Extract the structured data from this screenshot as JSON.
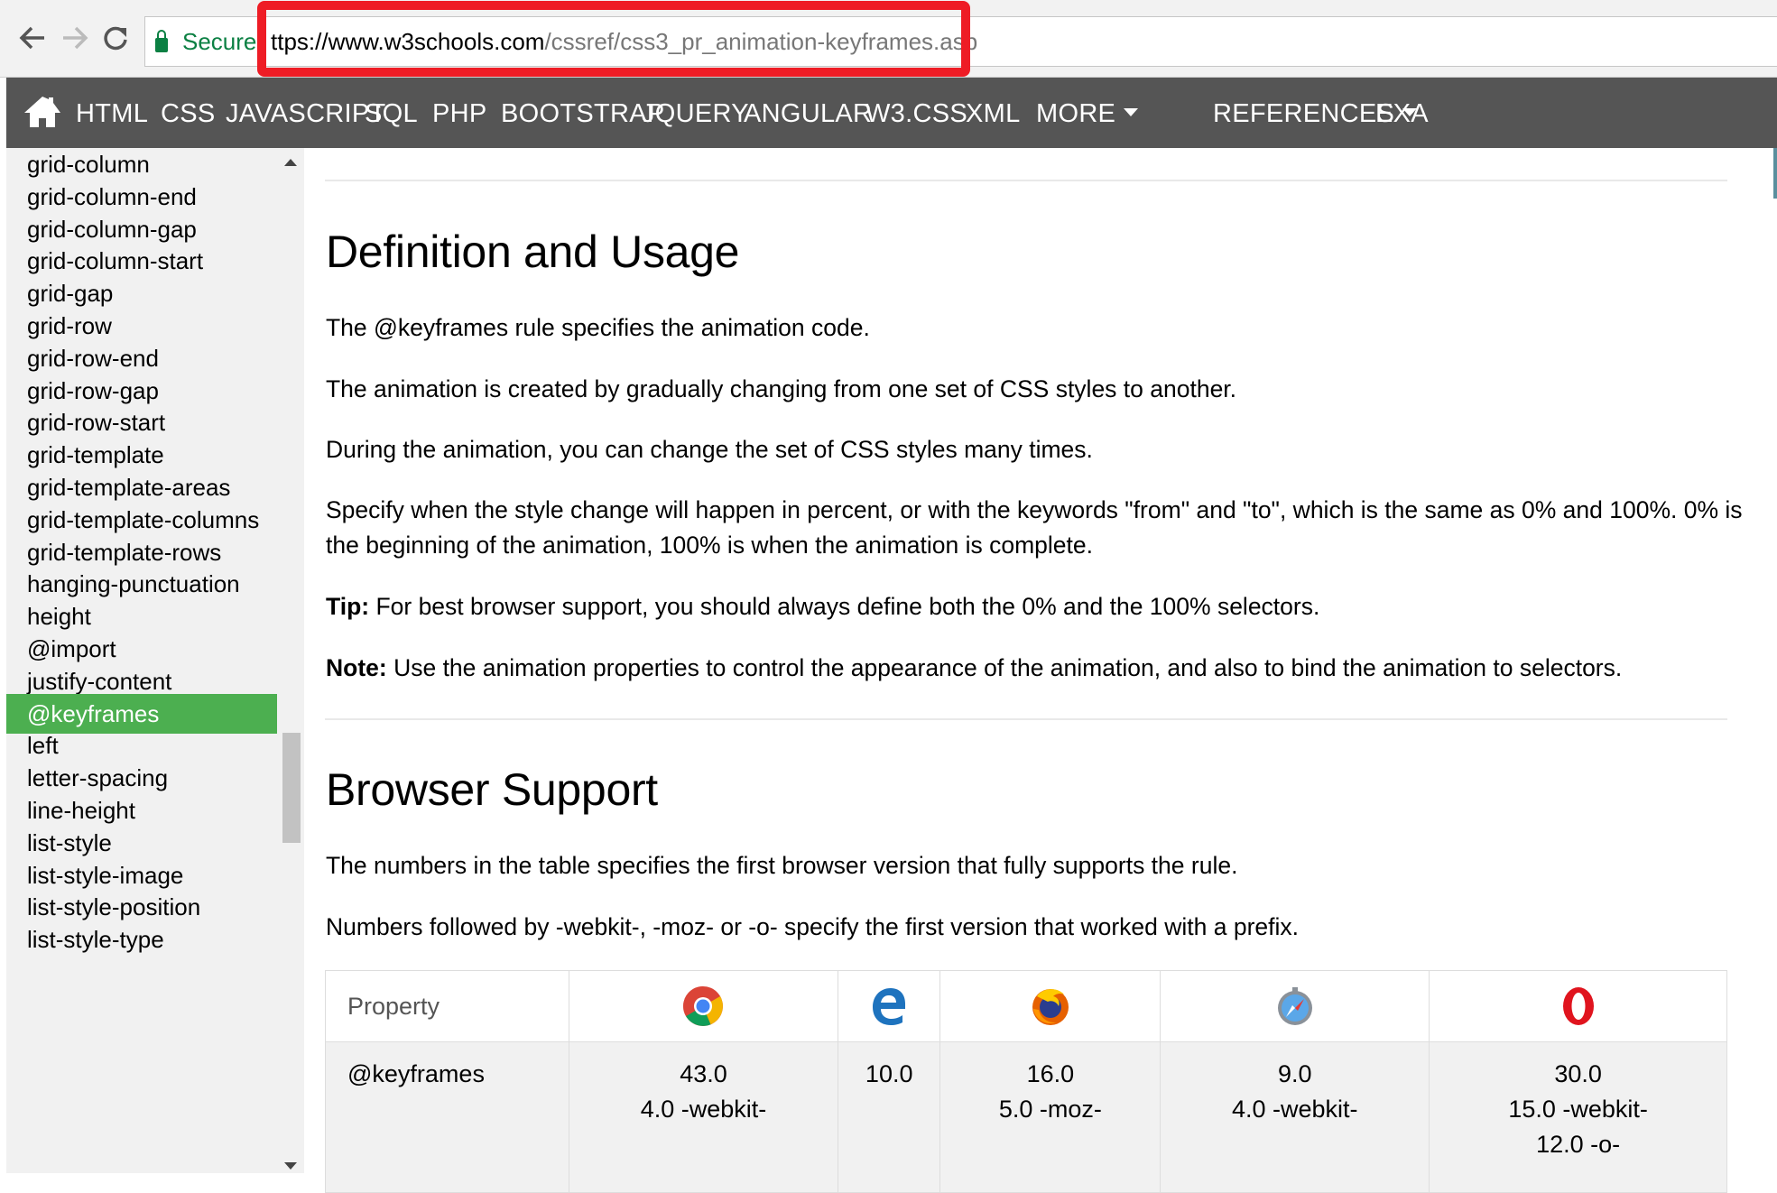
{
  "browser": {
    "secure_label": "Secure",
    "url_scheme": "https://",
    "url_host": "www.w3schools.com",
    "url_path": "/cssref/css3_pr_animation-keyframes.asp",
    "url_display_host": "ttps://www.w3schools.com",
    "back_icon": "back-arrow-icon",
    "forward_icon": "forward-arrow-icon",
    "reload_icon": "reload-icon",
    "highlight_color": "#ee1c25"
  },
  "topnav": {
    "items": [
      "HTML",
      "CSS",
      "JAVASCRIPT",
      "SQL",
      "PHP",
      "BOOTSTRAP",
      "JQUERY",
      "ANGULAR",
      "W3.CSS",
      "XML"
    ],
    "more": "MORE",
    "references": "REFERENCES",
    "exa": "EXA",
    "background": "#555555"
  },
  "sidebar": {
    "items": [
      "grid-column",
      "grid-column-end",
      "grid-column-gap",
      "grid-column-start",
      "grid-gap",
      "grid-row",
      "grid-row-end",
      "grid-row-gap",
      "grid-row-start",
      "grid-template",
      "grid-template-areas",
      "grid-template-columns",
      "grid-template-rows",
      "hanging-punctuation",
      "height",
      "@import",
      "justify-content",
      "@keyframes",
      "left",
      "letter-spacing",
      "line-height",
      "list-style",
      "list-style-image",
      "list-style-position",
      "list-style-type"
    ],
    "active": "@keyframes",
    "active_color": "#4caf50"
  },
  "main": {
    "definition_heading": "Definition and Usage",
    "p1": "The @keyframes rule specifies the animation code.",
    "p2": "The animation is created by gradually changing from one set of CSS styles to another.",
    "p3": "During the animation, you can change the set of CSS styles many times.",
    "p4_line1": "Specify when the style change will happen in percent, or with the keywords \"from\" and \"to\", which is the same as 0% and 100%. 0% is",
    "p4_line2": "the beginning of the animation, 100% is when the animation is complete.",
    "tip_label": "Tip:",
    "tip_text": " For best browser support, you should always define both the 0% and the 100% selectors.",
    "note_label": "Note:",
    "note_text": " Use the animation properties to control the appearance of the animation, and also to bind the animation to selectors.",
    "support_heading": "Browser Support",
    "support_p1": "The numbers in the table specifies the first browser version that fully supports the rule.",
    "support_p2": "Numbers followed by -webkit-, -moz- or -o- specify the first version that worked with a prefix."
  },
  "table": {
    "header_property": "Property",
    "browsers": [
      "chrome-icon",
      "edge-icon",
      "firefox-icon",
      "safari-icon",
      "opera-icon"
    ],
    "row": {
      "property": "@keyframes",
      "chrome": [
        "43.0",
        "4.0 -webkit-"
      ],
      "edge": [
        "10.0"
      ],
      "firefox": [
        "16.0",
        "5.0 -moz-"
      ],
      "safari": [
        "9.0",
        "4.0 -webkit-"
      ],
      "opera": [
        "30.0",
        "15.0 -webkit-",
        "12.0 -o-"
      ]
    }
  }
}
